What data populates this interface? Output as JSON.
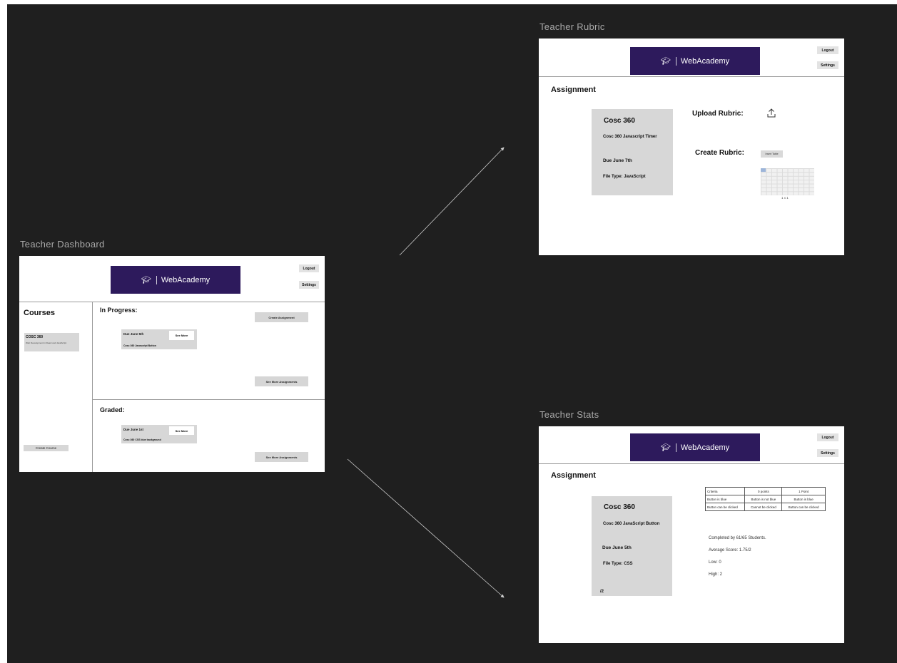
{
  "frames": {
    "dashboard": {
      "title": "Teacher Dashboard"
    },
    "rubric": {
      "title": "Teacher Rubric"
    },
    "stats": {
      "title": "Teacher Stats"
    }
  },
  "brand": {
    "name": "WebAcademy",
    "icon": "graduation-cap-icon"
  },
  "nav": {
    "logout": "Logout",
    "settings": "Settings"
  },
  "dashboard": {
    "courses_heading": "Courses",
    "course_card": {
      "title": "COSC 360",
      "description": "Web Development in React and JavaScript"
    },
    "create_course": "Create Course",
    "in_progress_heading": "In Progress:",
    "create_assignment": "Create Assignment",
    "in_progress_item": {
      "due": "Due June 5th",
      "see_more": "See More",
      "name": "Cosc 360 Javascript Button"
    },
    "see_more_assignments": "See More Assignments",
    "graded_heading": "Graded:",
    "graded_item": {
      "due": "Due June 1st",
      "see_more": "See More",
      "name": "Cosc 360 CSS blue background"
    },
    "see_more_assignments_2": "See More Assignments"
  },
  "rubric": {
    "heading": "Assignment",
    "card": {
      "course": "Cosc 360",
      "name": "Cosc 360 Javascript Timer",
      "due": "Due June 7th",
      "file_type": "File Type: JavaScript"
    },
    "upload_label": "Upload Rubric:",
    "upload_icon": "upload-icon",
    "create_label": "Create Rubric:",
    "insert_table": "Insert Table",
    "grid_size": "1 x 1"
  },
  "stats": {
    "heading": "Assignment",
    "card": {
      "course": "Cosc 360",
      "name": "Cosc 360 JavaScript Button",
      "due": "Due June 5th",
      "file_type": "File Type: CSS",
      "score": "/2"
    },
    "table": {
      "headers": [
        "Criteria",
        "0 points",
        "1 Point"
      ],
      "rows": [
        [
          "Button is blue",
          "Button is not blue",
          "Button is blue"
        ],
        [
          "Button can be clicked",
          "Cannot be clicked",
          "Button can be clicked"
        ]
      ]
    },
    "completed": "Completed by 61/65 Students.",
    "average": "Average Score: 1.75/2",
    "low": "Low: 0",
    "high": "High: 2"
  },
  "colors": {
    "canvas": "#1f1f1f",
    "banner": "#2d1a5c",
    "card": "#d7d7d7",
    "frame_title": "#a9a9a9"
  }
}
